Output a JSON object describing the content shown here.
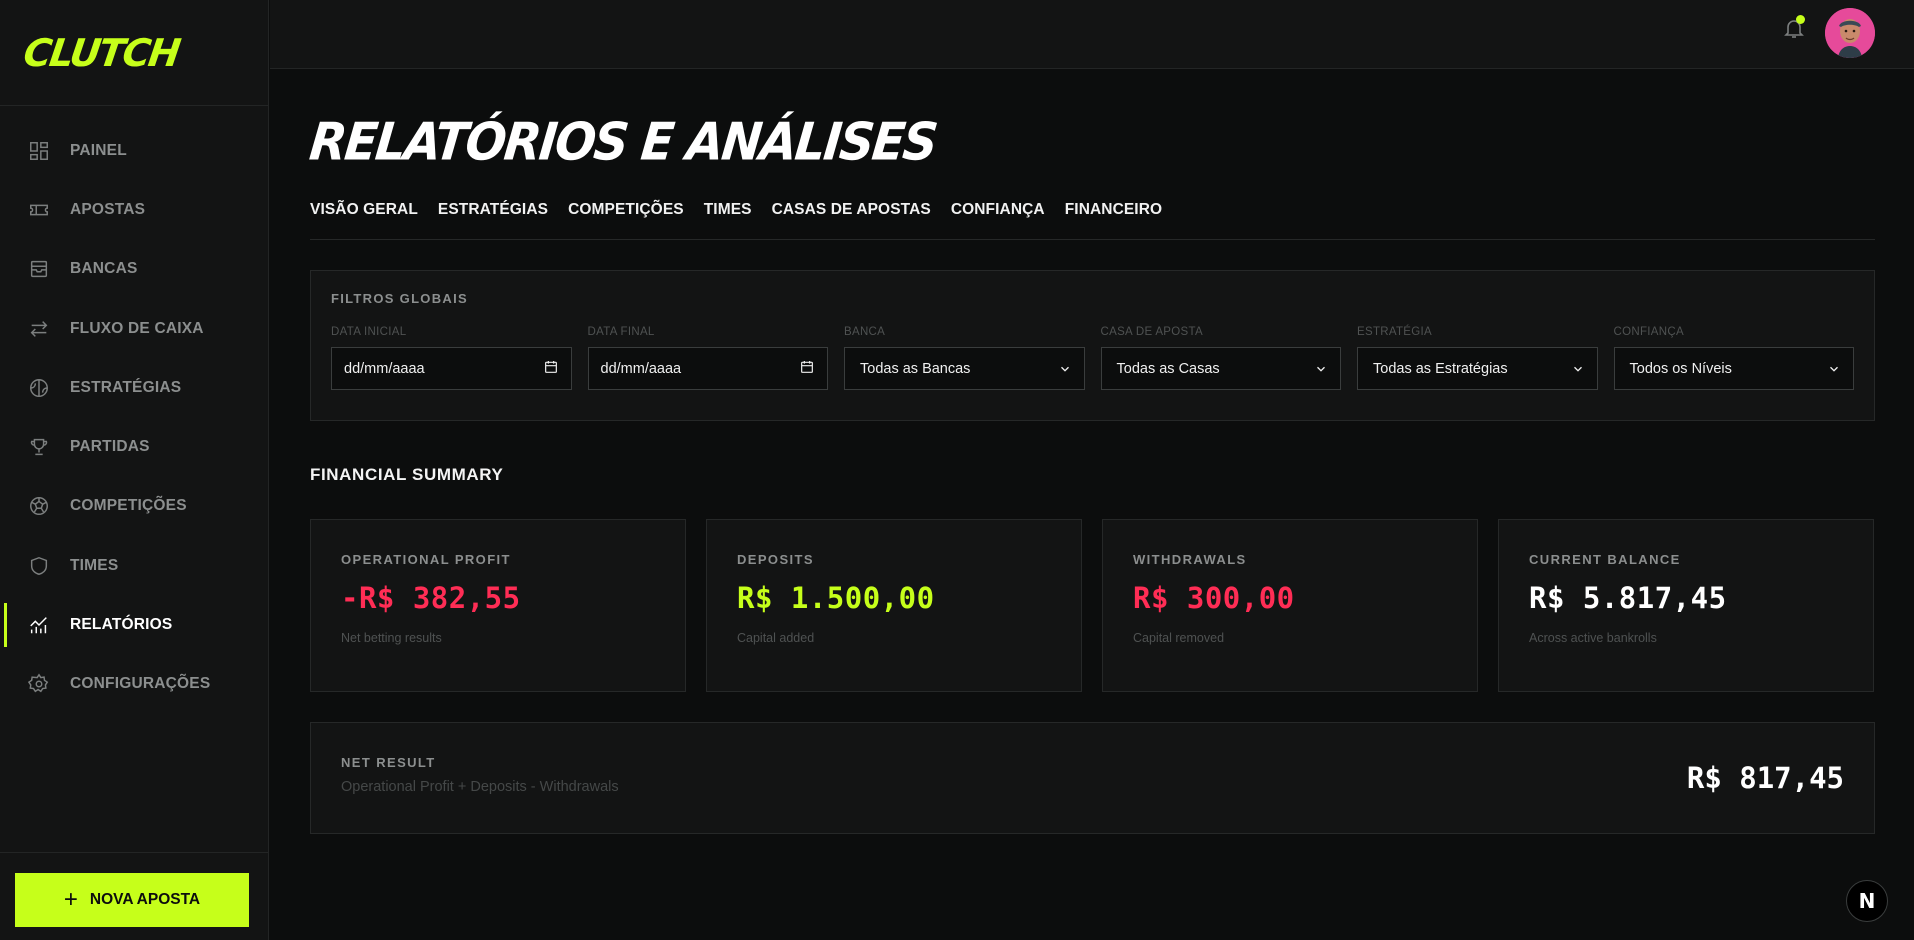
{
  "brand": {
    "logo_text": "CLUTCH",
    "accent": "#c6ff1a",
    "negative": "#ff2d55"
  },
  "sidebar": {
    "items": [
      {
        "label": "PAINEL",
        "icon": "dashboard-icon"
      },
      {
        "label": "APOSTAS",
        "icon": "ticket-icon"
      },
      {
        "label": "BANCAS",
        "icon": "wallet-icon"
      },
      {
        "label": "FLUXO DE CAIXA",
        "icon": "transfer-arrows-icon"
      },
      {
        "label": "ESTRATÉGIAS",
        "icon": "strategy-icon"
      },
      {
        "label": "PARTIDAS",
        "icon": "trophy-icon"
      },
      {
        "label": "COMPETIÇÕES",
        "icon": "soccer-ball-icon"
      },
      {
        "label": "TIMES",
        "icon": "shield-icon"
      },
      {
        "label": "RELATÓRIOS",
        "icon": "chart-line-icon",
        "active": true
      },
      {
        "label": "CONFIGURAÇÕES",
        "icon": "gear-icon"
      }
    ],
    "new_bet_label": "NOVA APOSTA"
  },
  "header": {
    "notification_icon": "bell-icon"
  },
  "page": {
    "title": "RELATÓRIOS E ANÁLISES",
    "tabs": [
      "VISÃO GERAL",
      "ESTRATÉGIAS",
      "COMPETIÇÕES",
      "TIMES",
      "CASAS DE APOSTAS",
      "CONFIANÇA",
      "FINANCEIRO"
    ]
  },
  "filters": {
    "title": "FILTROS GLOBAIS",
    "fields": [
      {
        "label": "DATA INICIAL",
        "value": "dd/mm/aaaa"
      },
      {
        "label": "DATA FINAL",
        "value": "dd/mm/aaaa"
      },
      {
        "label": "BANCA",
        "value": "Todas as Bancas"
      },
      {
        "label": "CASA DE APOSTA",
        "value": "Todas as Casas"
      },
      {
        "label": "ESTRATÉGIA",
        "value": "Todas as Estratégias"
      },
      {
        "label": "CONFIANÇA",
        "value": "Todos os Níveis"
      }
    ]
  },
  "summary": {
    "title": "FINANCIAL SUMMARY",
    "cards": [
      {
        "label": "OPERATIONAL PROFIT",
        "value": "-R$ 382,55",
        "sub": "Net betting results"
      },
      {
        "label": "DEPOSITS",
        "value": "R$ 1.500,00",
        "sub": "Capital added"
      },
      {
        "label": "WITHDRAWALS",
        "value": "R$ 300,00",
        "sub": "Capital removed"
      },
      {
        "label": "CURRENT BALANCE",
        "value": "R$ 5.817,45",
        "sub": "Across active bankrolls"
      }
    ],
    "net": {
      "label": "NET RESULT",
      "sub": "Operational Profit + Deposits - Withdrawals",
      "value": "R$ 817,45"
    }
  },
  "dev_badge": "N"
}
